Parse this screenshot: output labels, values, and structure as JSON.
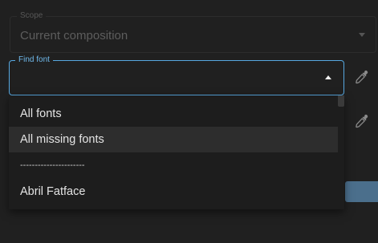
{
  "scope": {
    "label": "Scope",
    "value": "Current composition"
  },
  "find_font": {
    "label": "Find font",
    "value": "",
    "placeholder": ""
  },
  "dropdown": {
    "options": [
      "All fonts",
      "All missing fonts",
      "----------------------",
      "Abril Fatface"
    ],
    "hovered_index": 1
  },
  "icons": {
    "eyedropper_1": "eyedropper-icon",
    "eyedropper_2": "eyedropper-icon"
  },
  "colors": {
    "focus_accent": "#57a8e0",
    "button": "#4b6f8c",
    "background": "#202020"
  }
}
